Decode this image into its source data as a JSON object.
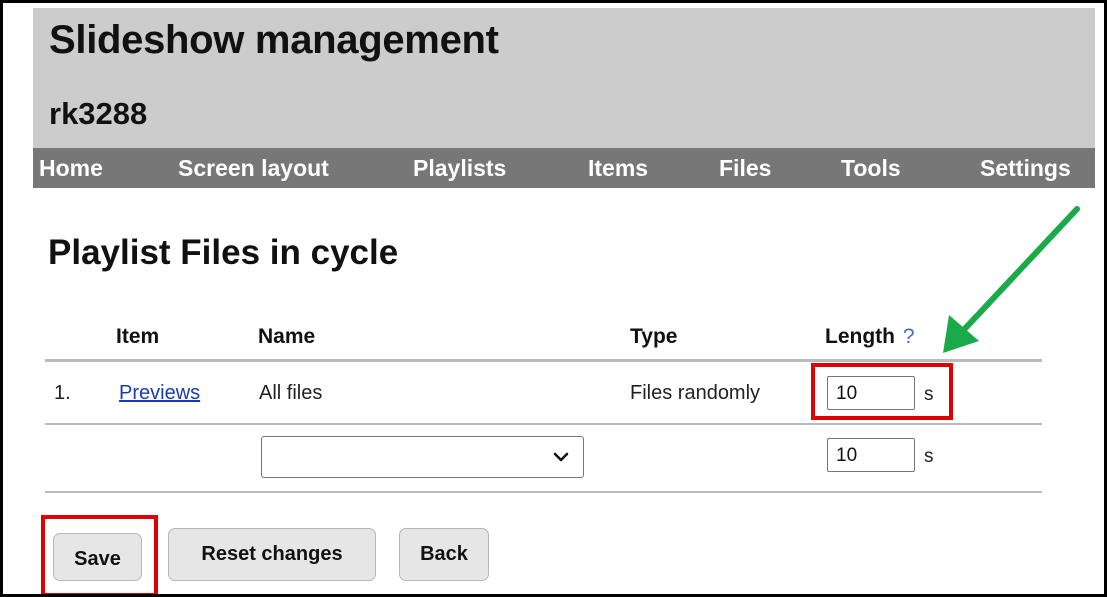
{
  "header": {
    "title": "Slideshow management",
    "device": "rk3288"
  },
  "nav": {
    "home": "Home",
    "screen_layout": "Screen layout",
    "playlists": "Playlists",
    "items": "Items",
    "files": "Files",
    "tools": "Tools",
    "settings": "Settings"
  },
  "page": {
    "title": "Playlist Files in cycle"
  },
  "table": {
    "headers": {
      "item": "Item",
      "name": "Name",
      "type": "Type",
      "length": "Length",
      "help": "?"
    },
    "rows": [
      {
        "index": "1.",
        "item": "Previews",
        "name": "All files",
        "type": "Files randomly",
        "length": "10",
        "unit": "s"
      }
    ],
    "new_row": {
      "select_value": "",
      "length": "10",
      "unit": "s"
    }
  },
  "buttons": {
    "save": "Save",
    "reset": "Reset changes",
    "back": "Back"
  },
  "annotations": {
    "highlight_color": "#e00000",
    "arrow_color": "#1aaa4a"
  },
  "icons": {
    "dropdown": "chevron-down-icon",
    "arrow": "green-arrow-icon"
  }
}
